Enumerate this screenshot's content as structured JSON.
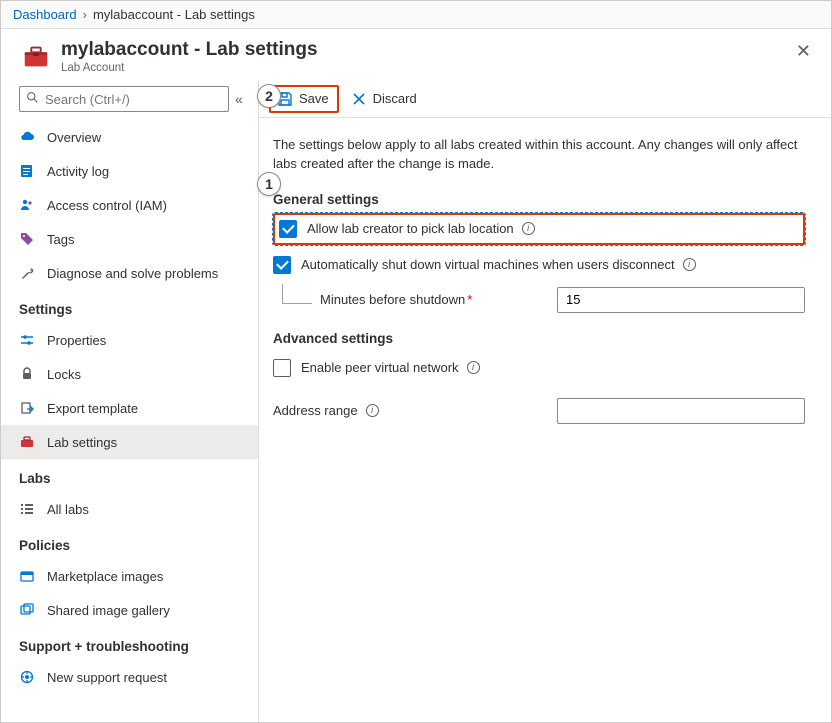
{
  "breadcrumb": {
    "root": "Dashboard",
    "current": "mylabaccount - Lab settings"
  },
  "header": {
    "title": "mylabaccount - Lab settings",
    "subtitle": "Lab Account"
  },
  "search": {
    "placeholder": "Search (Ctrl+/)"
  },
  "nav": {
    "top": [
      {
        "label": "Overview"
      },
      {
        "label": "Activity log"
      },
      {
        "label": "Access control (IAM)"
      },
      {
        "label": "Tags"
      },
      {
        "label": "Diagnose and solve problems"
      }
    ],
    "settings_heading": "Settings",
    "settings": [
      {
        "label": "Properties"
      },
      {
        "label": "Locks"
      },
      {
        "label": "Export template"
      },
      {
        "label": "Lab settings"
      }
    ],
    "labs_heading": "Labs",
    "labs": [
      {
        "label": "All labs"
      }
    ],
    "policies_heading": "Policies",
    "policies": [
      {
        "label": "Marketplace images"
      },
      {
        "label": "Shared image gallery"
      }
    ],
    "support_heading": "Support + troubleshooting",
    "support": [
      {
        "label": "New support request"
      }
    ]
  },
  "toolbar": {
    "save": "Save",
    "discard": "Discard"
  },
  "content": {
    "description": "The settings below apply to all labs created within this account. Any changes will only affect labs created after the change is made.",
    "general_heading": "General settings",
    "allow_pick_location": "Allow lab creator to pick lab location",
    "auto_shutdown": "Automatically shut down virtual machines when users disconnect",
    "minutes_label": "Minutes before shutdown",
    "minutes_value": "15",
    "advanced_heading": "Advanced settings",
    "peer_vnet": "Enable peer virtual network",
    "address_range": "Address range",
    "callout1": "1",
    "callout2": "2"
  }
}
